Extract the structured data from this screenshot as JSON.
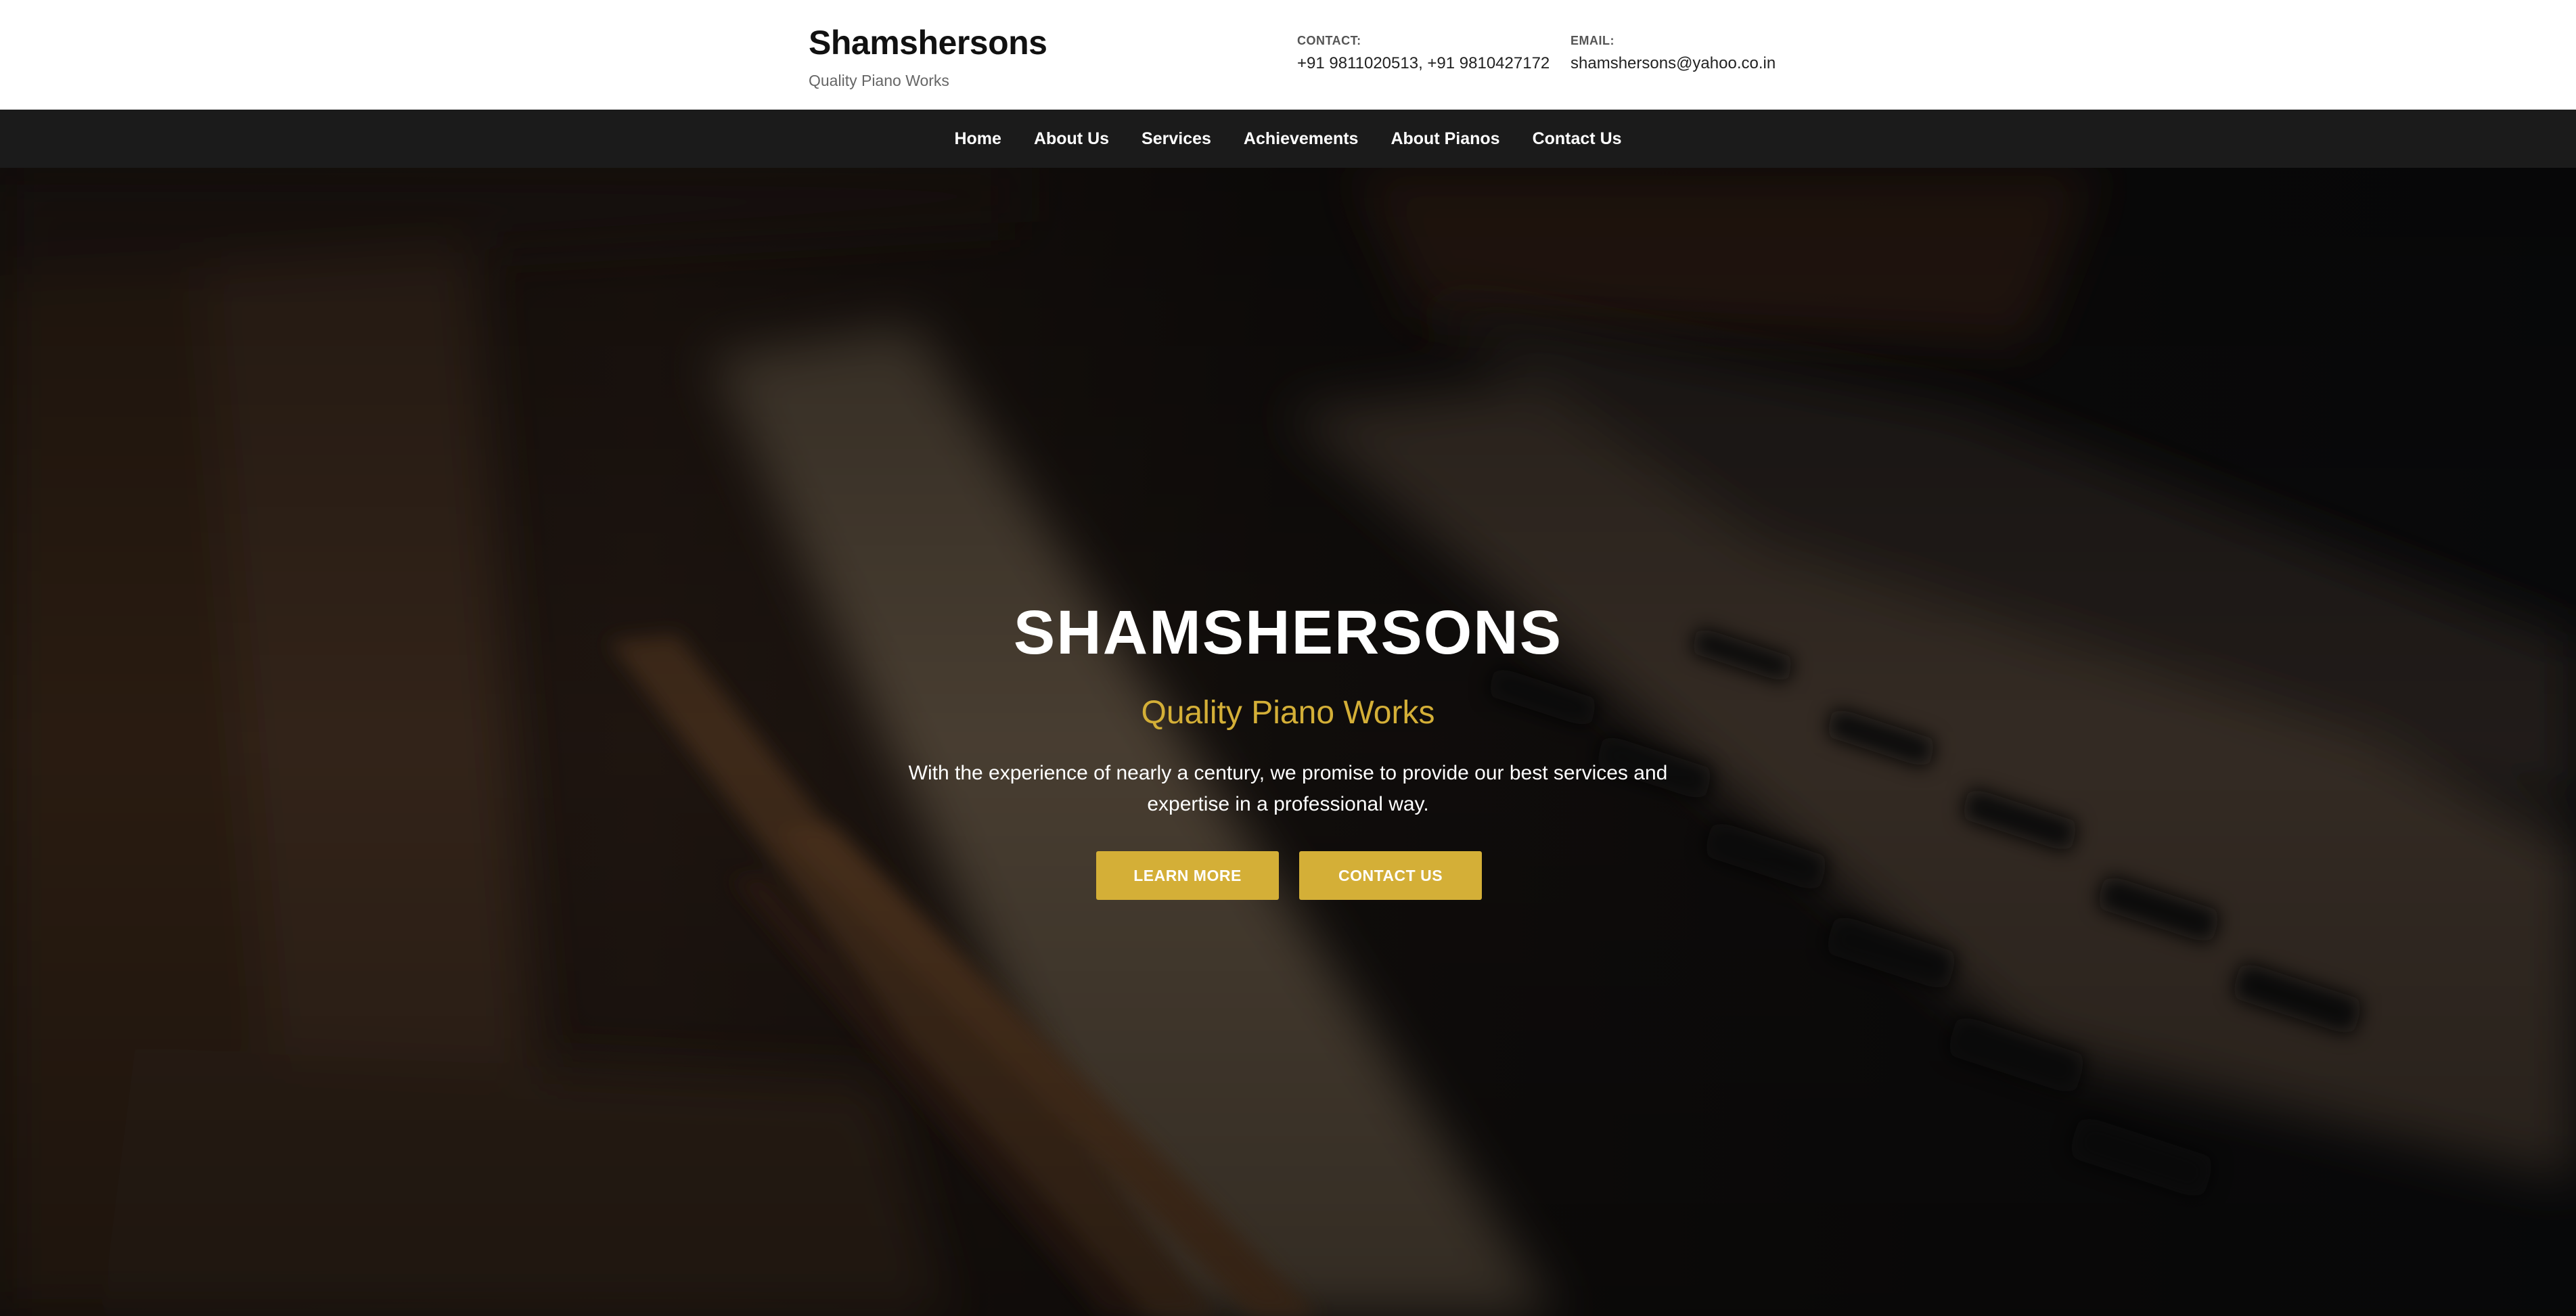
{
  "header": {
    "brand_name": "Shamshersons",
    "brand_tagline": "Quality Piano Works",
    "contact_label": "CONTACT:",
    "contact_value": "+91 9811020513, +91 9810427172",
    "email_label": "EMAIL:",
    "email_value": "shamshersons@yahoo.co.in"
  },
  "nav": {
    "items": [
      {
        "label": "Home"
      },
      {
        "label": "About Us"
      },
      {
        "label": "Services"
      },
      {
        "label": "Achievements"
      },
      {
        "label": "About Pianos"
      },
      {
        "label": "Contact Us"
      }
    ]
  },
  "hero": {
    "title": "SHAMSHERSONS",
    "subtitle": "Quality Piano Works",
    "description": "With the experience of nearly a century, we promise to provide our best services and expertise in a professional way.",
    "learn_more_label": "LEARN MORE",
    "contact_us_label": "CONTACT US",
    "background": "blurred-piano-keys-photo"
  },
  "colors": {
    "accent": "#d4af37",
    "nav_background": "#1b1b1b",
    "header_background": "#ffffff"
  }
}
